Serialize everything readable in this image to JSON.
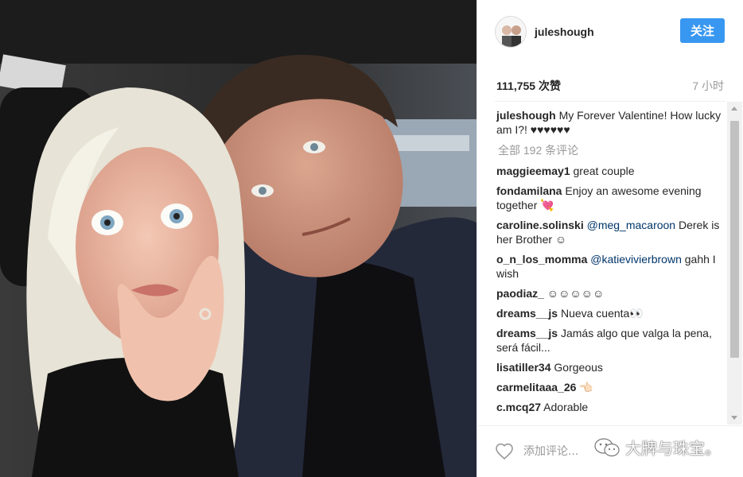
{
  "header": {
    "username": "juleshough",
    "follow_label": "关注"
  },
  "stats": {
    "likes": "111,755 次赞",
    "time": "7 小时"
  },
  "caption": {
    "user": "juleshough",
    "text": "My Forever Valentine! How lucky am I?! ♥♥♥♥♥♥"
  },
  "view_all": "全部 192 条评论",
  "comments": [
    {
      "user": "maggieemay1",
      "mention": "",
      "text": "great couple"
    },
    {
      "user": "fondamilana",
      "mention": "",
      "text": "Enjoy an awesome evening together 💘"
    },
    {
      "user": "caroline.solinski",
      "mention": "@meg_macaroon",
      "text": "Derek is her Brother ☺"
    },
    {
      "user": "o_n_los_momma",
      "mention": "@katievivierbrown",
      "text": "gahh I wish"
    },
    {
      "user": "paodiaz_",
      "mention": "",
      "text": "☺☺☺☺☺"
    },
    {
      "user": "dreams__js",
      "mention": "",
      "text": "Nueva cuenta👀"
    },
    {
      "user": "dreams__js",
      "mention": "",
      "text": "Jamás algo que valga la pena, será fácil..."
    },
    {
      "user": "lisatiller34",
      "mention": "",
      "text": "Gorgeous"
    },
    {
      "user": "carmelitaaa_26",
      "mention": "",
      "text": "👈🏻"
    },
    {
      "user": "c.mcq27",
      "mention": "",
      "text": "Adorable"
    }
  ],
  "footer": {
    "placeholder": "添加评论...",
    "watermark": "大牌与珠宝。"
  },
  "icons": {
    "heart": "heart-icon",
    "wechat": "wechat-icon"
  },
  "colors": {
    "follow_button": "#3897f0",
    "mention": "#003569",
    "muted": "#999999"
  }
}
